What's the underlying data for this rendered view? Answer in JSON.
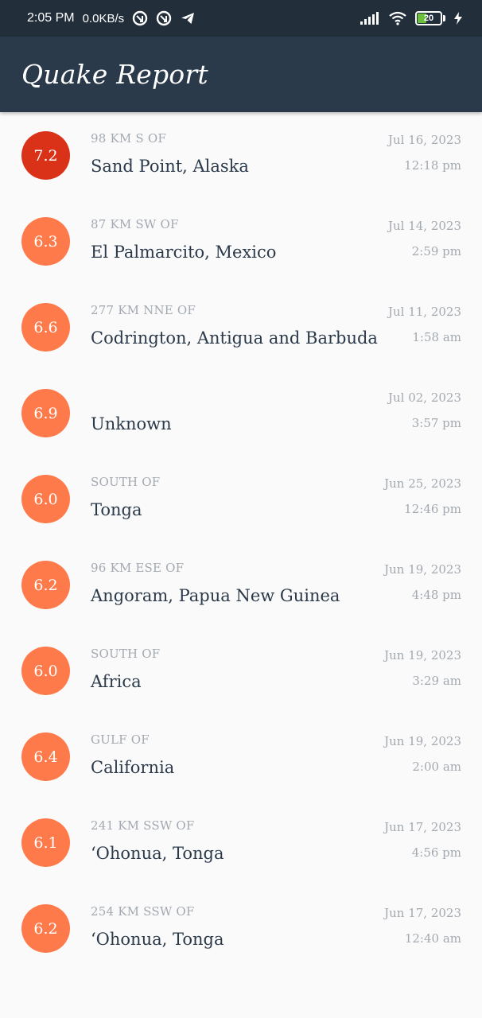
{
  "status_bar": {
    "time": "2:05 PM",
    "network_speed": "0.0KB/s",
    "battery_level": "20",
    "icons": [
      "notification-icon",
      "notification-icon",
      "telegram-icon",
      "signal-icon",
      "wifi-icon",
      "battery-icon",
      "charging-icon"
    ]
  },
  "app_bar": {
    "title": "Quake Report"
  },
  "colors": {
    "mag_high": "#d93218",
    "mag_default": "#ff7a4a",
    "status_bar_bg": "#222e3a",
    "app_bar_bg": "#2b3a4a",
    "primary_text": "#2b3a4a",
    "secondary_text": "#a3a9b0"
  },
  "earthquakes": [
    {
      "magnitude": "7.2",
      "offset": "98 KM S OF",
      "location": "Sand Point, Alaska",
      "date": "Jul 16, 2023",
      "time": "12:18 pm",
      "color": "#d93218"
    },
    {
      "magnitude": "6.3",
      "offset": "87 KM SW OF",
      "location": "El Palmarcito, Mexico",
      "date": "Jul 14, 2023",
      "time": "2:59 pm",
      "color": "#ff7a4a"
    },
    {
      "magnitude": "6.6",
      "offset": "277 KM NNE OF",
      "location": "Codrington, Antigua and Barbuda",
      "date": "Jul 11, 2023",
      "time": "1:58 am",
      "color": "#ff7a4a"
    },
    {
      "magnitude": "6.9",
      "offset": "",
      "location": "Unknown",
      "date": "Jul 02, 2023",
      "time": "3:57 pm",
      "color": "#ff7a4a"
    },
    {
      "magnitude": "6.0",
      "offset": "SOUTH OF",
      "location": "Tonga",
      "date": "Jun 25, 2023",
      "time": "12:46 pm",
      "color": "#ff7a4a"
    },
    {
      "magnitude": "6.2",
      "offset": "96 KM ESE OF",
      "location": "Angoram, Papua New Guinea",
      "date": "Jun 19, 2023",
      "time": "4:48 pm",
      "color": "#ff7a4a"
    },
    {
      "magnitude": "6.0",
      "offset": "SOUTH OF",
      "location": "Africa",
      "date": "Jun 19, 2023",
      "time": "3:29 am",
      "color": "#ff7a4a"
    },
    {
      "magnitude": "6.4",
      "offset": "GULF OF",
      "location": "California",
      "date": "Jun 19, 2023",
      "time": "2:00 am",
      "color": "#ff7a4a"
    },
    {
      "magnitude": "6.1",
      "offset": "241 KM SSW OF",
      "location": "ʻOhonua, Tonga",
      "date": "Jun 17, 2023",
      "time": "4:56 pm",
      "color": "#ff7a4a"
    },
    {
      "magnitude": "6.2",
      "offset": "254 KM SSW OF",
      "location": "ʻOhonua, Tonga",
      "date": "Jun 17, 2023",
      "time": "12:40 am",
      "color": "#ff7a4a"
    }
  ]
}
